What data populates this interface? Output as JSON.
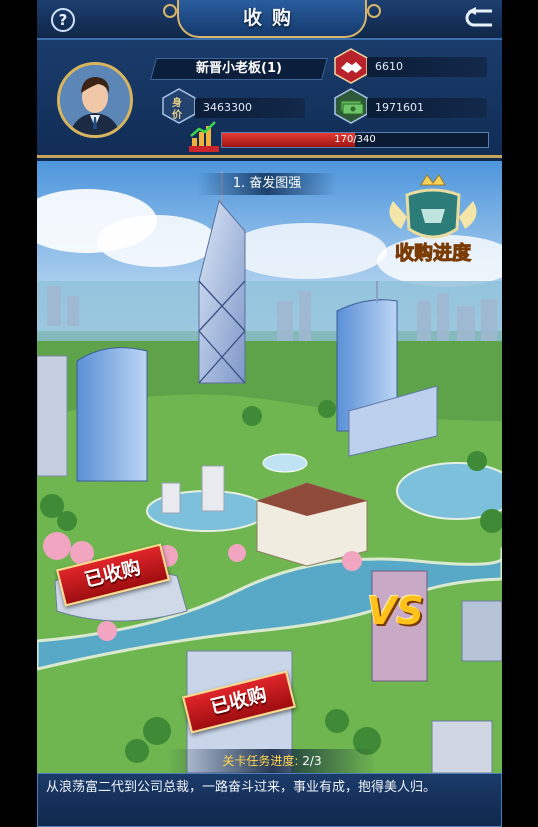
{
  "header": {
    "title": "收购",
    "help_icon": "question-mark-icon",
    "back_icon": "return-arrow-icon"
  },
  "player": {
    "name": "新晋小老板(1)",
    "reputation_label": "身价",
    "reputation_value": "3463300",
    "deals_value": "6610",
    "cash_value": "1971601",
    "market_label": "市值",
    "market_progress_text": "170/340",
    "market_progress_fraction": 0.5
  },
  "map": {
    "level_title": "1. 奋发图强",
    "progress_badge_label": "收购进度",
    "acquired_stamp_1": "已收购",
    "acquired_stamp_2": "已收购",
    "vs_label": "VS",
    "task_progress_label": "关卡任务进度:",
    "task_progress_value": "2/3"
  },
  "description": {
    "text": "从浪荡富二代到公司总裁，一路奋斗过来，事业有成，抱得美人归。"
  },
  "colors": {
    "panel_blue": "#1a3c6c",
    "gold_trim": "#d7b66a",
    "market_red": "#e83a34",
    "stamp_red": "#e0252a",
    "task_yellow": "#ffd54a"
  }
}
